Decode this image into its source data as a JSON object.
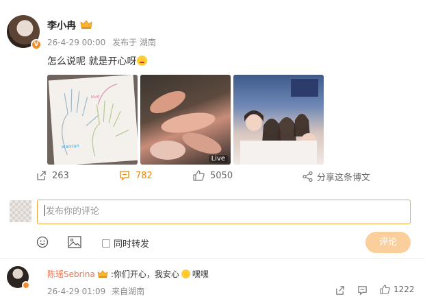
{
  "post": {
    "username": "李小冉",
    "time": "26-4-29 00:00",
    "location": "发布于 湖南",
    "text": "怎么说呢 就是开心呀",
    "text_emoji": "smile-emoji",
    "live_label": "Live",
    "actions": {
      "repost_count": "263",
      "comment_count": "782",
      "like_count": "5050",
      "share_label": "分享这条博文"
    }
  },
  "compose": {
    "placeholder": "发布你的评论",
    "sync_label": "同时转发",
    "submit_label": "评论"
  },
  "reply": {
    "username": "陈瑶Sebrina",
    "text_before": ":你们开心，我安心",
    "text_after": "嘿嘿",
    "time": "26-4-29 01:09",
    "source": "来自湖南",
    "like_count": "1222"
  },
  "colors": {
    "accent": "#e8880e",
    "submit_bg": "#fbcf9c",
    "input_border": "#f0a63c",
    "name_link": "#eb7350",
    "badge": "#f28c28"
  }
}
